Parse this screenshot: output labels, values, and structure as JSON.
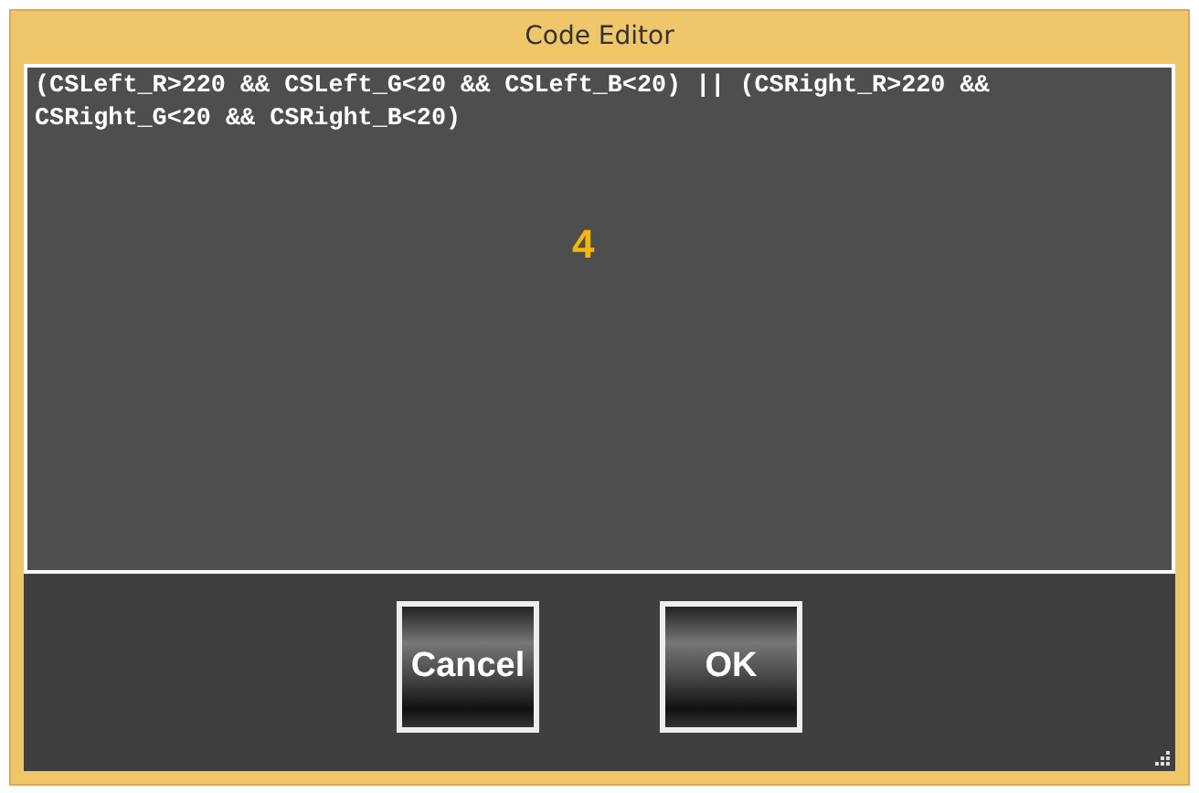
{
  "window": {
    "title": "Code Editor"
  },
  "editor": {
    "code": "(CSLeft_R>220 && CSLeft_G<20 && CSLeft_B<20) || (CSRight_R>220 && CSRight_G<20 && CSRight_B<20)",
    "marker": "4"
  },
  "buttons": [
    {
      "label": "Cancel"
    },
    {
      "label": "OK"
    }
  ]
}
